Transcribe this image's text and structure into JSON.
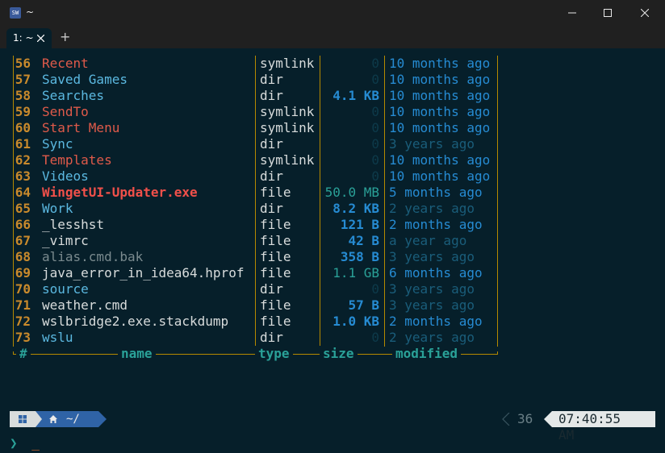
{
  "window": {
    "title": "~",
    "app_icon": "SW"
  },
  "tabs": [
    {
      "label": "1: ~"
    }
  ],
  "new_tab_label": "+",
  "table": {
    "headers": {
      "index": "#",
      "name": "name",
      "type": "type",
      "size": "size",
      "modified": "modified"
    },
    "rows": [
      {
        "index": "56",
        "name": "Recent",
        "type": "symlink",
        "size": "0",
        "modified": "10 months ago"
      },
      {
        "index": "57",
        "name": "Saved Games",
        "type": "dir",
        "size": "0",
        "modified": "10 months ago"
      },
      {
        "index": "58",
        "name": "Searches",
        "type": "dir",
        "size": "4.1 KB",
        "modified": "10 months ago"
      },
      {
        "index": "59",
        "name": "SendTo",
        "type": "symlink",
        "size": "0",
        "modified": "10 months ago"
      },
      {
        "index": "60",
        "name": "Start Menu",
        "type": "symlink",
        "size": "0",
        "modified": "10 months ago"
      },
      {
        "index": "61",
        "name": "Sync",
        "type": "dir",
        "size": "0",
        "modified": "3 years ago"
      },
      {
        "index": "62",
        "name": "Templates",
        "type": "symlink",
        "size": "0",
        "modified": "10 months ago"
      },
      {
        "index": "63",
        "name": "Videos",
        "type": "dir",
        "size": "0",
        "modified": "10 months ago"
      },
      {
        "index": "64",
        "name": "WingetUI-Updater.exe",
        "type": "file",
        "size": "50.0 MB",
        "modified": "5 months ago"
      },
      {
        "index": "65",
        "name": "Work",
        "type": "dir",
        "size": "8.2 KB",
        "modified": "2 years ago"
      },
      {
        "index": "66",
        "name": "_lesshst",
        "type": "file",
        "size": "121 B",
        "modified": "2 months ago"
      },
      {
        "index": "67",
        "name": "_vimrc",
        "type": "file",
        "size": "42 B",
        "modified": "a year ago"
      },
      {
        "index": "68",
        "name": "alias.cmd.bak",
        "type": "file",
        "size": "358 B",
        "modified": "3 years ago"
      },
      {
        "index": "69",
        "name": "java_error_in_idea64.hprof",
        "type": "file",
        "size": "1.1 GB",
        "modified": "6 months ago"
      },
      {
        "index": "70",
        "name": "source",
        "type": "dir",
        "size": "0",
        "modified": "3 years ago"
      },
      {
        "index": "71",
        "name": "weather.cmd",
        "type": "file",
        "size": "57 B",
        "modified": "3 years ago"
      },
      {
        "index": "72",
        "name": "wslbridge2.exe.stackdump",
        "type": "file",
        "size": "1.0 KB",
        "modified": "2 months ago"
      },
      {
        "index": "73",
        "name": "wslu",
        "type": "dir",
        "size": "0",
        "modified": "2 years ago"
      }
    ]
  },
  "prompt": {
    "os_icon": "windows-icon",
    "home_icon": "home-icon",
    "path": "~/",
    "last_exit": "36",
    "time": "07:40:55 AM",
    "caret": "❯",
    "cursor": "_"
  },
  "colors": {
    "background": "#061f2a",
    "border": "#b58900",
    "index": "#c98a2c",
    "symlink": "#e05a4a",
    "dir": "#5bb8e0",
    "exe": "#f0504a",
    "file": "#d8dcdc",
    "hidden": "#7a8a8e",
    "header": "#2aa198",
    "size": "#268bd2",
    "modified": "#268bd2",
    "modified_dim": "#1a5d7a",
    "accent_dir": "#2f63a6",
    "cursor": "#e06a2a"
  }
}
